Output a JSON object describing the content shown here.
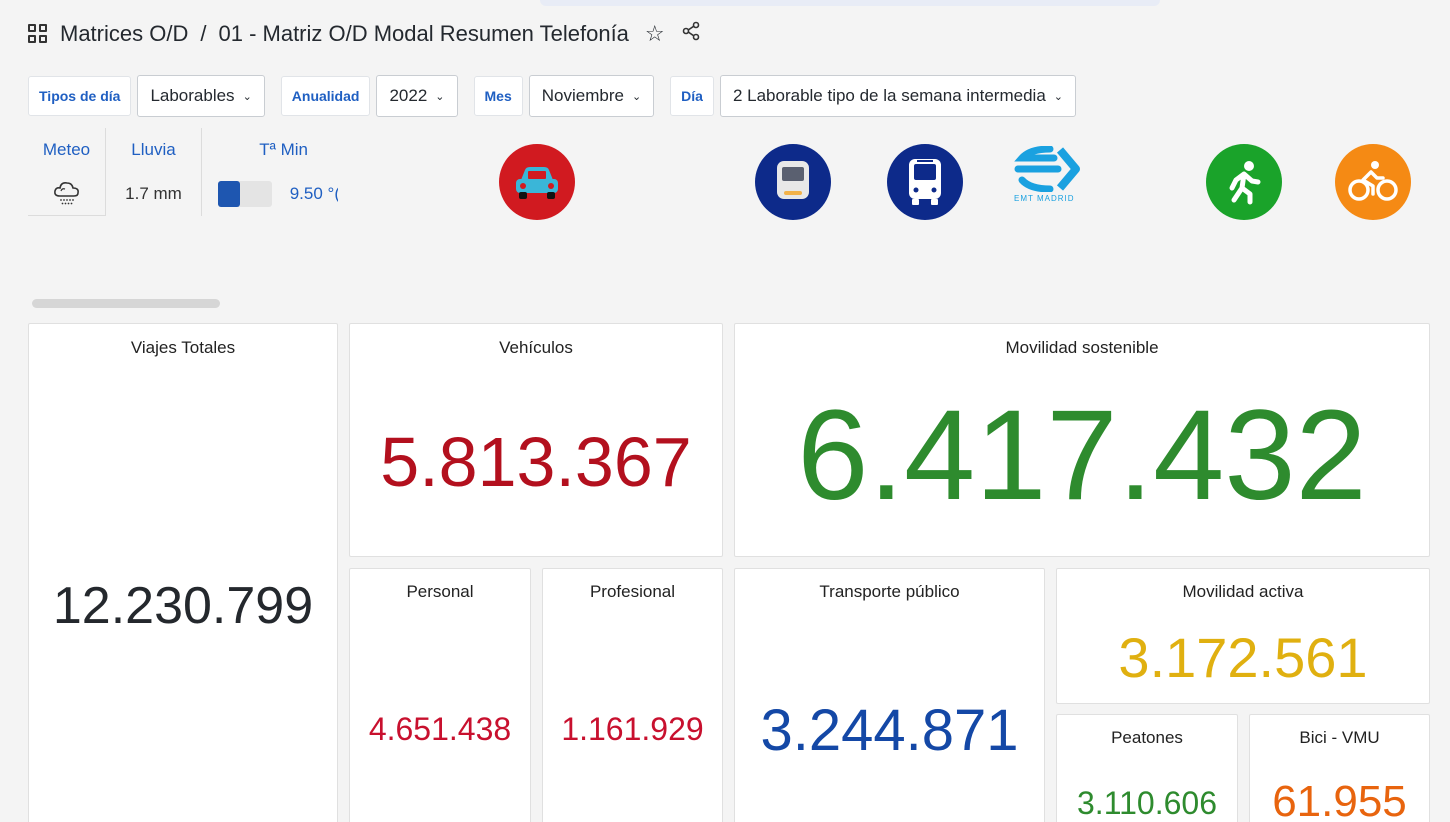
{
  "header": {
    "breadcrumb_root": "Matrices O/D",
    "separator": "/",
    "title": "01 - Matriz O/D Modal Resumen Telefonía"
  },
  "filters": [
    {
      "label": "Tipos de día",
      "value": "Laborables"
    },
    {
      "label": "Anualidad",
      "value": "2022"
    },
    {
      "label": "Mes",
      "value": "Noviembre"
    },
    {
      "label": "Día",
      "value": "2 Laborable tipo de la semana intermedia"
    }
  ],
  "weather": {
    "meteo_label": "Meteo",
    "rain_label": "Lluvia",
    "rain_value": "1.7 mm",
    "tmin_label": "Tª Min",
    "tmin_value": "9.50 °(",
    "meteo_icon": "rain-cloud-icon"
  },
  "modes": {
    "car_icon": "car-icon",
    "train_icon": "train-icon",
    "bus_icon": "bus-icon",
    "emt_logo_text": "EMT MADRID",
    "walk_icon": "pedestrian-icon",
    "bike_icon": "bicycle-icon"
  },
  "cards": {
    "total": {
      "title": "Viajes Totales",
      "value": "12.230.799"
    },
    "vehicles": {
      "title": "Vehículos",
      "value": "5.813.367"
    },
    "sustainable": {
      "title": "Movilidad sostenible",
      "value": "6.417.432"
    },
    "personal": {
      "title": "Personal",
      "value": "4.651.438"
    },
    "professional": {
      "title": "Profesional",
      "value": "1.161.929"
    },
    "public_transport": {
      "title": "Transporte público",
      "value": "3.244.871"
    },
    "active": {
      "title": "Movilidad activa",
      "value": "3.172.561"
    },
    "pedestrians": {
      "title": "Peatones",
      "value": "3.110.606"
    },
    "bike": {
      "title": "Bici - VMU",
      "value": "61.955"
    }
  },
  "colors": {
    "accent_blue": "#1f5fc2",
    "vehicle_red": "#b3101e",
    "personal_red": "#c8102e",
    "sustainable_green": "#2e8b2e",
    "transit_blue": "#1448a6",
    "active_yellow": "#e0b010",
    "bike_orange": "#e8640e",
    "car_circle": "#d11a20",
    "transit_circle": "#0d2a8a",
    "walk_circle": "#1aa32a",
    "bike_circle": "#f58a14"
  }
}
